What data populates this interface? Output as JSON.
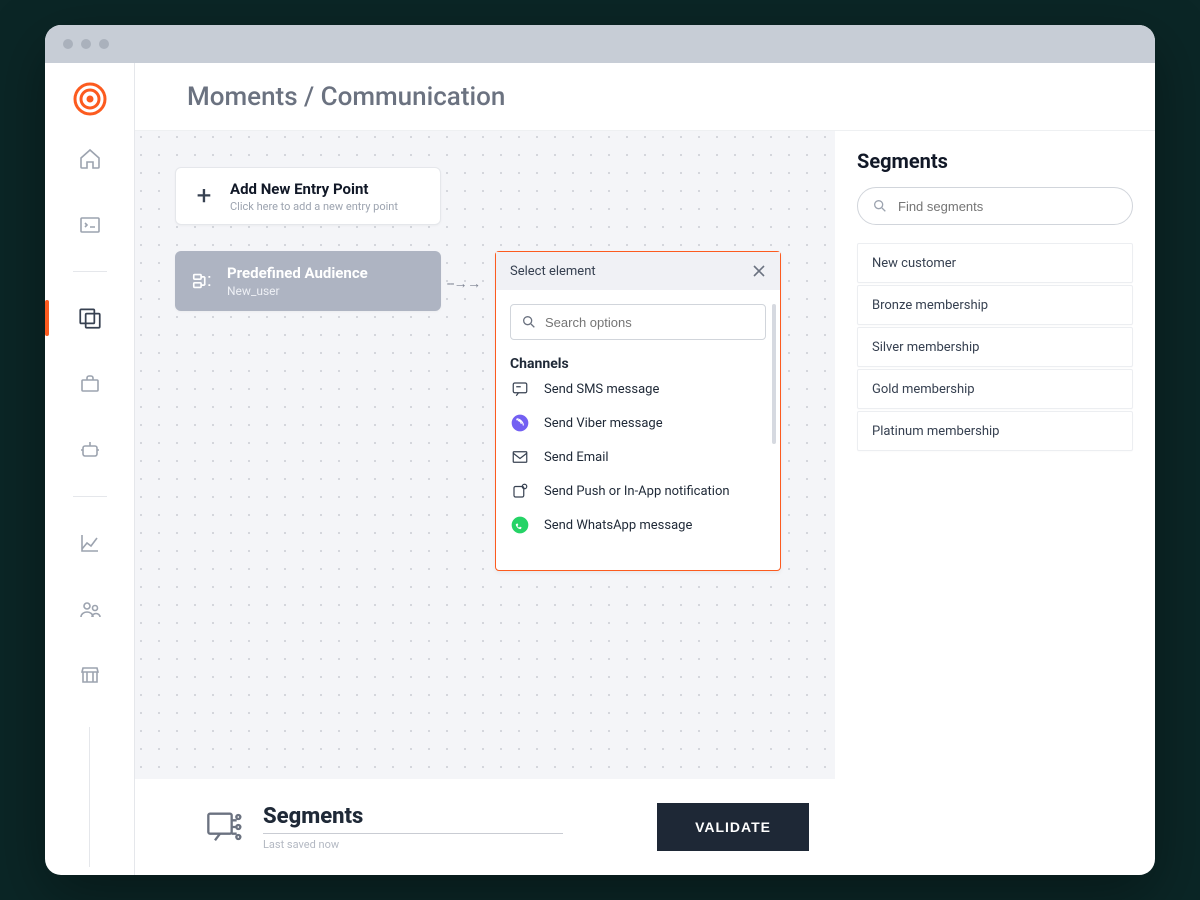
{
  "breadcrumb": "Moments / Communication",
  "sidebar": {
    "items": [
      "home",
      "terminal",
      "moments",
      "briefcase",
      "bot",
      "analytics",
      "people",
      "store"
    ],
    "active_index": 2
  },
  "canvas": {
    "entry": {
      "title": "Add New Entry Point",
      "subtitle": "Click here to add a new entry point"
    },
    "audience": {
      "title": "Predefined Audience",
      "subtitle": "New_user"
    }
  },
  "popup": {
    "header": "Select element",
    "search_placeholder": "Search options",
    "section_label": "Channels",
    "items": [
      {
        "icon": "sms",
        "label": "Send SMS message"
      },
      {
        "icon": "viber",
        "label": "Send Viber message"
      },
      {
        "icon": "email",
        "label": "Send Email"
      },
      {
        "icon": "push",
        "label": "Send Push or In-App notification"
      },
      {
        "icon": "whatsapp",
        "label": "Send WhatsApp message"
      }
    ]
  },
  "segments": {
    "title": "Segments",
    "search_placeholder": "Find segments",
    "items": [
      "New customer",
      "Bronze membership",
      "Silver membership",
      "Gold membership",
      "Platinum membership"
    ]
  },
  "footer": {
    "title": "Segments",
    "subtitle": "Last saved now",
    "validate": "VALIDATE"
  }
}
